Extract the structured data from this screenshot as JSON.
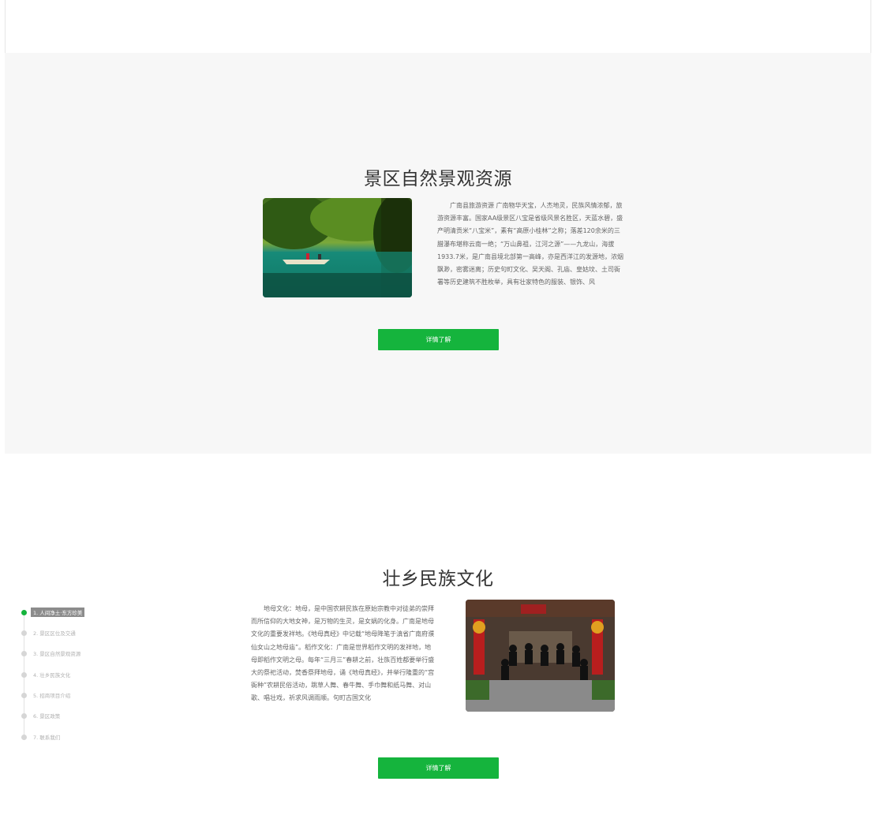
{
  "section_nature": {
    "title": "景区自然景观资源",
    "description": "广南县旅游资源 广南物华天宝，人杰地灵，民族风情浓郁，旅游资源丰富。国家AA级景区八宝是省级风景名胜区，天蓝水碧，盛产明清贡米“八宝米”，素有“高原小桂林”之称；落差120余米的三腊瀑布堪称云南一绝；“万山鼻祖，江河之源”——九龙山，海拔1933.7米，是广南县境北部第一高峰，亦是西洋江的发源地，浓烟飘渺，密雾迷离；历史句町文化、吴天阁、孔庙、皇姑坟、土司衙署等历史建筑不胜枚举，具有壮家特色的服装、银饰、风",
    "button_label": "详情了解"
  },
  "section_culture": {
    "title": "壮乡民族文化",
    "description": "地母文化：地母，是中国农耕民族在原始宗教中对徒弟的崇拜而所信仰的大地女神，是万物的生灵，是女娲的化身。广南是地母文化的重要发祥地。《地母真经》中记载“地母降笔于滇省广南府濮仙女山之地母庙”。稻作文化：广南是世界稻作文明的发祥地，地母即稻作文明之母。每年“三月三”春耕之前，壮族百姓都要举行盛大的祭祀活动，焚香祭拜地母，诵《地母真经》，并举行隆重的“宫衙种”农耕民俗活动，跳草人舞、春牛舞、手巾舞和纸马舞、对山歌、唱壮戏，祈求风调雨顺。句町古国文化",
    "button_label": "详情了解"
  },
  "side_nav": {
    "items": [
      {
        "label": "1. 人间净土·东方珍美"
      },
      {
        "label": "2. 景区区位及交通"
      },
      {
        "label": "3. 景区自然景观资源"
      },
      {
        "label": "4. 壮乡民族文化"
      },
      {
        "label": "5. 招商项目介绍"
      },
      {
        "label": "6. 景区政策"
      },
      {
        "label": "7. 联系我们"
      }
    ],
    "active_index": 0
  },
  "colors": {
    "accent": "#15b43d",
    "gray_section": "#f7f7f7"
  }
}
